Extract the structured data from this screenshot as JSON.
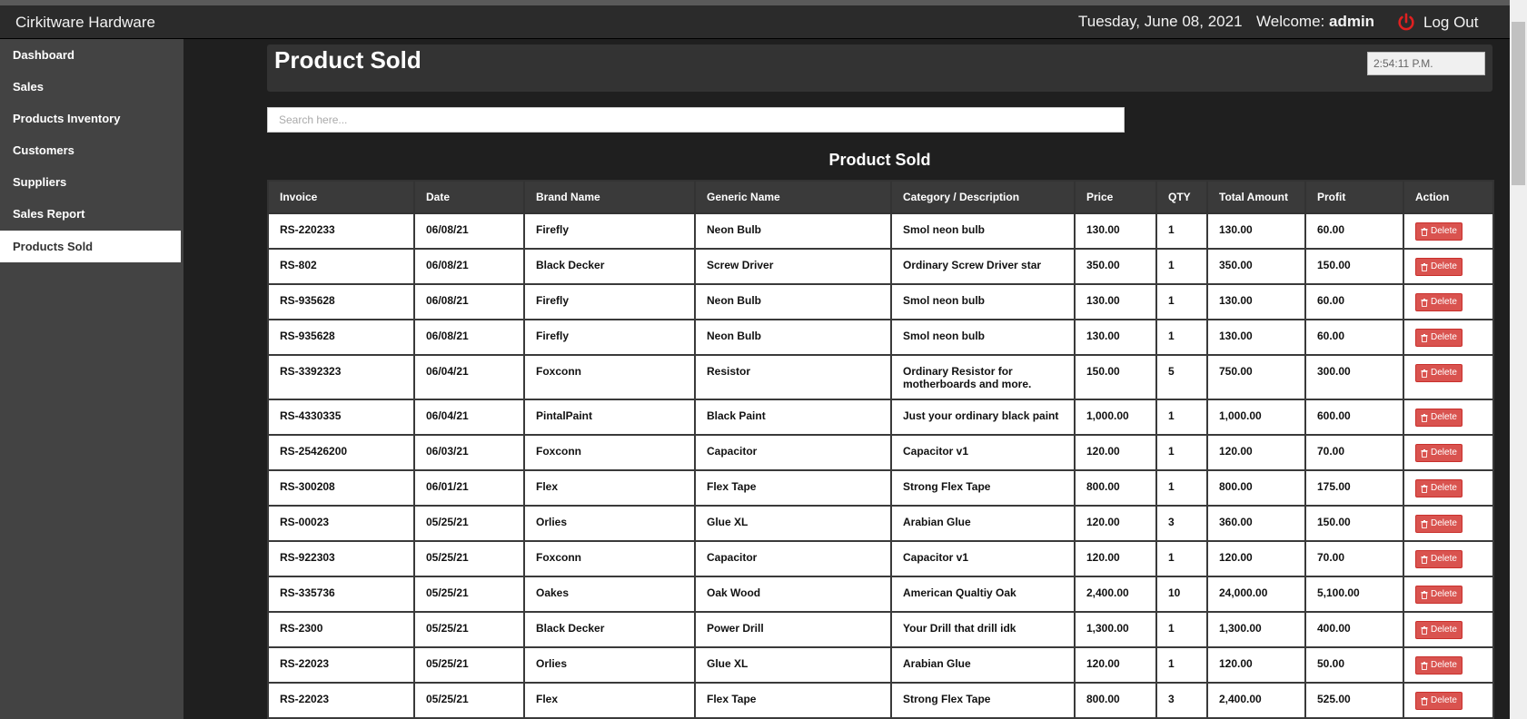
{
  "app": {
    "title": "Cirkitware Hardware",
    "date": "Tuesday, June 08, 2021",
    "welcome_prefix": "Welcome:",
    "user": "admin",
    "logout_label": "Log Out"
  },
  "sidebar": {
    "items": [
      {
        "label": "Dashboard"
      },
      {
        "label": "Sales"
      },
      {
        "label": "Products Inventory"
      },
      {
        "label": "Customers"
      },
      {
        "label": "Suppliers"
      },
      {
        "label": "Sales Report"
      },
      {
        "label": "Products Sold"
      }
    ],
    "active": "Products Sold"
  },
  "header": {
    "title": "Product Sold",
    "clock": "2:54:11 P.M."
  },
  "search": {
    "placeholder": "Search here..."
  },
  "table": {
    "title": "Product Sold",
    "columns": [
      "Invoice",
      "Date",
      "Brand Name",
      "Generic Name",
      "Category / Description",
      "Price",
      "QTY",
      "Total Amount",
      "Profit",
      "Action"
    ],
    "delete_label": "Delete",
    "rows": [
      [
        "RS-220233",
        "06/08/21",
        "Firefly",
        "Neon Bulb",
        "Smol neon bulb",
        "130.00",
        "1",
        "130.00",
        "60.00"
      ],
      [
        "RS-802",
        "06/08/21",
        "Black Decker",
        "Screw Driver",
        "Ordinary Screw Driver star",
        "350.00",
        "1",
        "350.00",
        "150.00"
      ],
      [
        "RS-935628",
        "06/08/21",
        "Firefly",
        "Neon Bulb",
        "Smol neon bulb",
        "130.00",
        "1",
        "130.00",
        "60.00"
      ],
      [
        "RS-935628",
        "06/08/21",
        "Firefly",
        "Neon Bulb",
        "Smol neon bulb",
        "130.00",
        "1",
        "130.00",
        "60.00"
      ],
      [
        "RS-3392323",
        "06/04/21",
        "Foxconn",
        "Resistor",
        "Ordinary Resistor for motherboards and more.",
        "150.00",
        "5",
        "750.00",
        "300.00"
      ],
      [
        "RS-4330335",
        "06/04/21",
        "PintalPaint",
        "Black Paint",
        "Just your ordinary black paint",
        "1,000.00",
        "1",
        "1,000.00",
        "600.00"
      ],
      [
        "RS-25426200",
        "06/03/21",
        "Foxconn",
        "Capacitor",
        "Capacitor v1",
        "120.00",
        "1",
        "120.00",
        "70.00"
      ],
      [
        "RS-300208",
        "06/01/21",
        "Flex",
        "Flex Tape",
        "Strong Flex Tape",
        "800.00",
        "1",
        "800.00",
        "175.00"
      ],
      [
        "RS-00023",
        "05/25/21",
        "Orlies",
        "Glue XL",
        "Arabian Glue",
        "120.00",
        "3",
        "360.00",
        "150.00"
      ],
      [
        "RS-922303",
        "05/25/21",
        "Foxconn",
        "Capacitor",
        "Capacitor v1",
        "120.00",
        "1",
        "120.00",
        "70.00"
      ],
      [
        "RS-335736",
        "05/25/21",
        "Oakes",
        "Oak Wood",
        "American Qualtiy Oak",
        "2,400.00",
        "10",
        "24,000.00",
        "5,100.00"
      ],
      [
        "RS-2300",
        "05/25/21",
        "Black Decker",
        "Power Drill",
        "Your Drill that drill idk",
        "1,300.00",
        "1",
        "1,300.00",
        "400.00"
      ],
      [
        "RS-22023",
        "05/25/21",
        "Orlies",
        "Glue XL",
        "Arabian Glue",
        "120.00",
        "1",
        "120.00",
        "50.00"
      ],
      [
        "RS-22023",
        "05/25/21",
        "Flex",
        "Flex Tape",
        "Strong Flex Tape",
        "800.00",
        "3",
        "2,400.00",
        "525.00"
      ]
    ]
  },
  "colors": {
    "navbar": "#2b2b2b",
    "sidebar": "#434343",
    "background": "#1f1f1f",
    "delete_button": "#d9534f",
    "logout_icon": "#e02020"
  },
  "icons": {
    "logout": "power-icon",
    "delete": "trash-icon"
  }
}
